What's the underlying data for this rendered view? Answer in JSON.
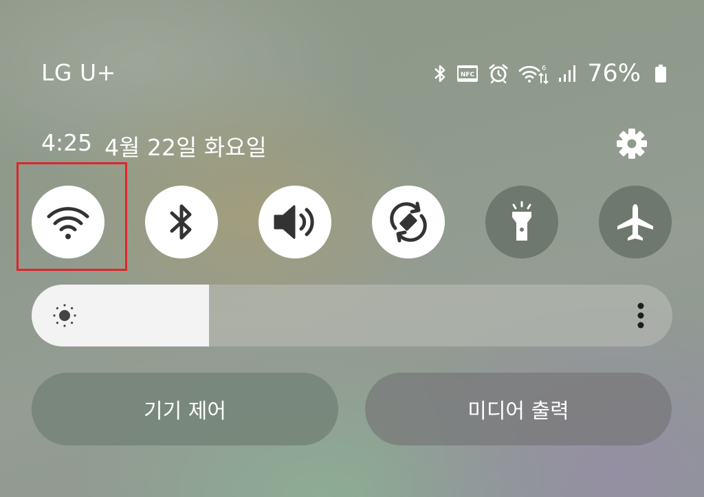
{
  "status_bar": {
    "carrier": "LG U+",
    "battery_percent": "76%",
    "icons": [
      "bluetooth-icon",
      "nfc-icon",
      "alarm-icon",
      "wifi-6-icon",
      "signal-icon",
      "battery-icon"
    ],
    "nfc_label": "NFC"
  },
  "header": {
    "time": "4:25",
    "date": "4월 22일 화요일"
  },
  "quick_toggles": [
    {
      "name": "wifi",
      "icon": "wifi-icon",
      "state": "on"
    },
    {
      "name": "bluetooth",
      "icon": "bluetooth-icon",
      "state": "on"
    },
    {
      "name": "sound",
      "icon": "volume-icon",
      "state": "on"
    },
    {
      "name": "auto-rotate",
      "icon": "rotate-icon",
      "state": "on"
    },
    {
      "name": "flashlight",
      "icon": "flashlight-icon",
      "state": "off"
    },
    {
      "name": "airplane-mode",
      "icon": "airplane-icon",
      "state": "off"
    }
  ],
  "brightness": {
    "level": 0.277
  },
  "buttons": {
    "device_control": "기기 제어",
    "media_output": "미디어 출력"
  },
  "colors": {
    "highlight": "#e0242c",
    "toggle_on": "#ffffff",
    "toggle_off": "#6f786e",
    "icon_dark": "#333333"
  }
}
